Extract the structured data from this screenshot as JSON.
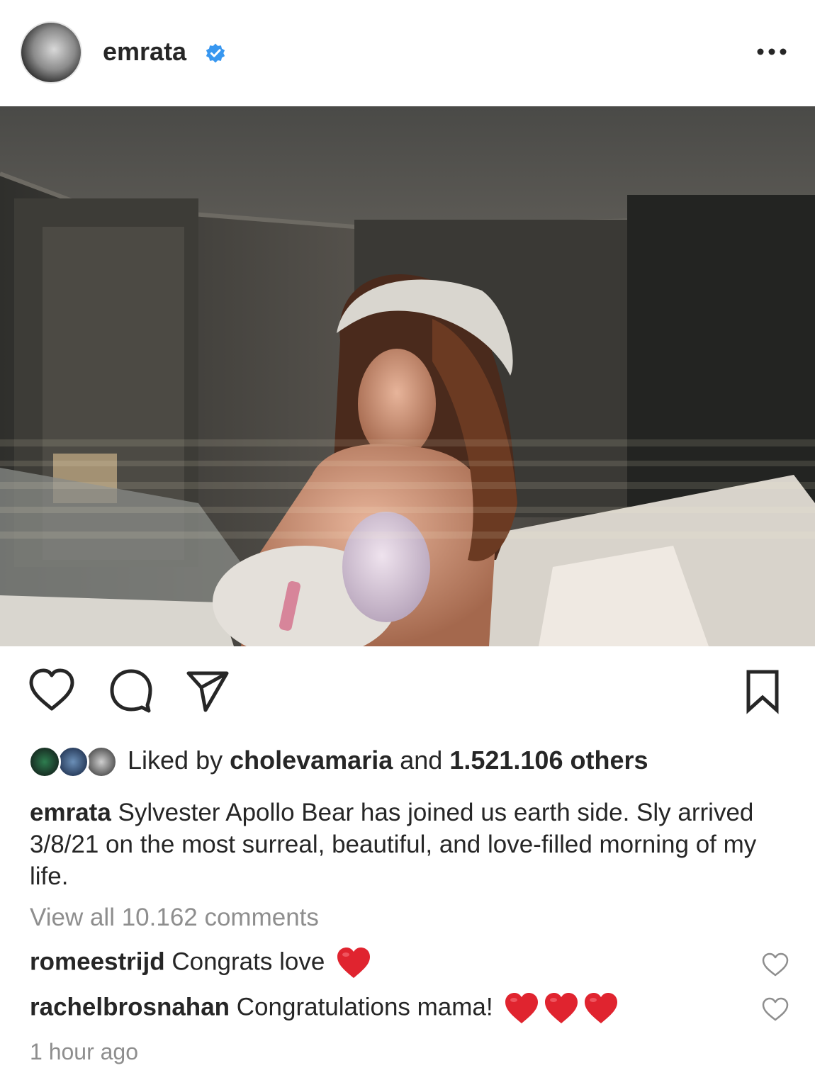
{
  "header": {
    "username": "emrata",
    "verified_color": "#3897f0"
  },
  "post": {
    "image_alt_icon": "photo"
  },
  "actions": {
    "icons": [
      "heart-outline-icon",
      "comment-icon",
      "share-icon",
      "bookmark-icon"
    ]
  },
  "likes": {
    "prefix": "Liked by ",
    "user": "cholevamaria",
    "middle": " and ",
    "count": "1.521.106 others"
  },
  "caption": {
    "username": "emrata",
    "text": " Sylvester Apollo Bear has joined us earth side. Sly arrived 3/8/21 on the most surreal, beautiful, and love-filled morning of my life."
  },
  "comments": {
    "view_all": "View all 10.162 comments",
    "items": [
      {
        "username": "romeestrijd",
        "text": " Congrats love",
        "emoji_hearts": 1
      },
      {
        "username": "rachelbrosnahan",
        "text": " Congratulations mama!",
        "emoji_hearts": 3
      }
    ]
  },
  "timestamp": "1 hour ago",
  "colors": {
    "text": "#262626",
    "muted": "#8e8e8e",
    "heart_red": "#e0242f"
  }
}
